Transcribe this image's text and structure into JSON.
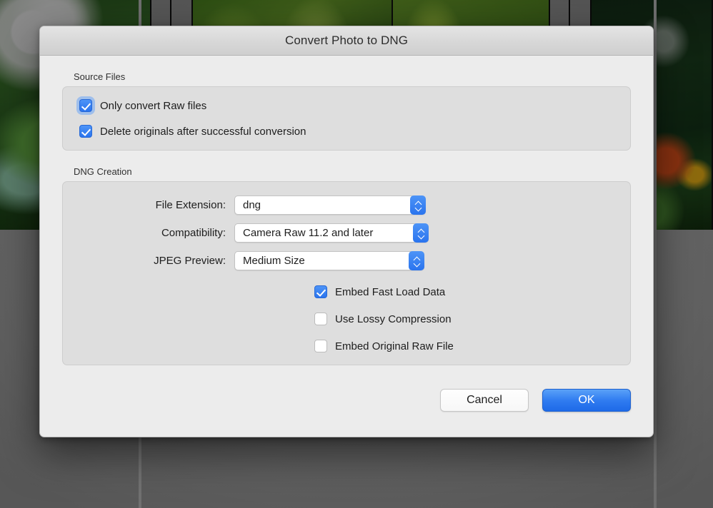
{
  "dialog": {
    "title": "Convert Photo to DNG"
  },
  "source_files": {
    "group_label": "Source Files",
    "checkboxes": [
      {
        "label": "Only convert Raw files",
        "checked": true,
        "focused": true
      },
      {
        "label": "Delete originals after successful conversion",
        "checked": true,
        "focused": false
      }
    ]
  },
  "dng_creation": {
    "group_label": "DNG Creation",
    "fields": [
      {
        "label": "File Extension:",
        "value": "dng"
      },
      {
        "label": "Compatibility:",
        "value": "Camera Raw 11.2 and later"
      },
      {
        "label": "JPEG Preview:",
        "value": "Medium Size"
      }
    ],
    "checkboxes": [
      {
        "label": "Embed Fast Load Data",
        "checked": true
      },
      {
        "label": "Use Lossy Compression",
        "checked": false
      },
      {
        "label": "Embed Original Raw File",
        "checked": false
      }
    ]
  },
  "footer": {
    "cancel_label": "Cancel",
    "ok_label": "OK"
  },
  "colors": {
    "accent_blue": "#2a74ee",
    "dialog_background": "#ececec",
    "group_background": "#dedede",
    "titlebar": "#d7d7d7",
    "desktop_backdrop": "#545454"
  }
}
